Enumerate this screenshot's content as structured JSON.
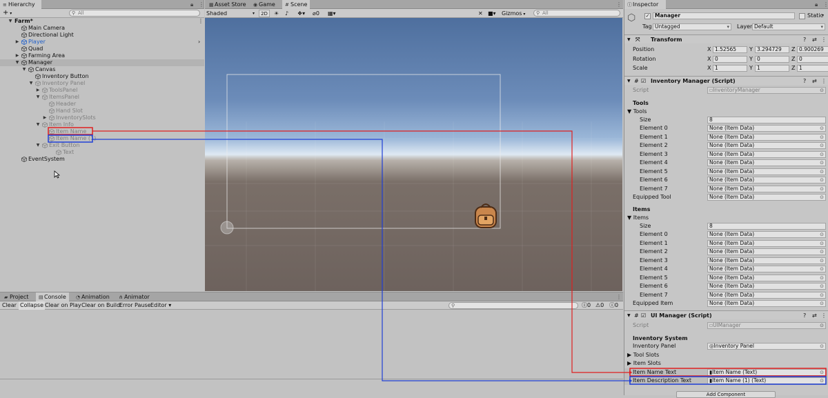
{
  "hierarchy": {
    "tab": "Hierarchy",
    "add": "+",
    "search_placeholder": "All",
    "rows": [
      {
        "label": "Farm*",
        "style": "bold"
      },
      {
        "label": "Main Camera"
      },
      {
        "label": "Directional Light"
      },
      {
        "label": "Player",
        "style": "blue"
      },
      {
        "label": "Quad"
      },
      {
        "label": "Farming Area"
      },
      {
        "label": "Manager",
        "style": "selected"
      },
      {
        "label": "Canvas"
      },
      {
        "label": "Inventory Button"
      },
      {
        "label": "Inventory Panel",
        "style": "dim"
      },
      {
        "label": "ToolsPanel",
        "style": "dim"
      },
      {
        "label": "ItemsPanel",
        "style": "dim"
      },
      {
        "label": "Header",
        "style": "dim"
      },
      {
        "label": "Hand Slot",
        "style": "dim"
      },
      {
        "label": "InventorySlots",
        "style": "dim"
      },
      {
        "label": "Item Info",
        "style": "dim"
      },
      {
        "label": "Item Name",
        "style": "dim"
      },
      {
        "label": "Item Name (1)",
        "style": "dim"
      },
      {
        "label": "Exit Button",
        "style": "dim"
      },
      {
        "label": "Text",
        "style": "dim"
      },
      {
        "label": "EventSystem"
      }
    ]
  },
  "scene_tabs": {
    "asset_store": "Asset Store",
    "game": "Game",
    "scene": "Scene"
  },
  "scene_toolbar": {
    "shading": "Shaded",
    "mode_2d": "2D",
    "gizmos": "Gizmos",
    "gizmo_count": "0",
    "search_placeholder": "All"
  },
  "bottom": {
    "tabs": {
      "project": "Project",
      "console": "Console",
      "animation": "Animation",
      "animator": "Animator"
    },
    "buttons": {
      "clear": "Clear",
      "collapse": "Collapse",
      "clear_on_play": "Clear on Play",
      "clear_on_build": "Clear on Build",
      "error_pause": "Error Pause",
      "editor": "Editor"
    },
    "counts": {
      "info": "0",
      "warn": "0",
      "error": "0"
    }
  },
  "inspector": {
    "tab": "Inspector",
    "object_name": "Manager",
    "static_label": "Static",
    "tag_label": "Tag",
    "tag_value": "Untagged",
    "layer_label": "Layer",
    "layer_value": "Default",
    "transform": {
      "title": "Transform",
      "position_label": "Position",
      "pos": {
        "x": "1.52565",
        "y": "3.294729",
        "z": "0.900269"
      },
      "rotation_label": "Rotation",
      "rot": {
        "x": "0",
        "y": "0",
        "z": "0"
      },
      "scale_label": "Scale",
      "scale": {
        "x": "1",
        "y": "1",
        "z": "1"
      }
    },
    "inventory_manager": {
      "title": "Inventory Manager (Script)",
      "script_label": "Script",
      "script_value": "InventoryManager",
      "tools_header": "Tools",
      "tools_foldout": "Tools",
      "size_label": "Size",
      "tools_size": "8",
      "tool_elements": [
        "Element 0",
        "Element 1",
        "Element 2",
        "Element 3",
        "Element 4",
        "Element 5",
        "Element 6",
        "Element 7"
      ],
      "none_value": "None (Item Data)",
      "equipped_tool_label": "Equipped Tool",
      "items_header": "Items",
      "items_foldout": "Items",
      "items_size": "8",
      "item_elements": [
        "Element 0",
        "Element 1",
        "Element 2",
        "Element 3",
        "Element 4",
        "Element 5",
        "Element 6",
        "Element 7"
      ],
      "equipped_item_label": "Equipped Item"
    },
    "ui_manager": {
      "title": "UI Manager (Script)",
      "script_label": "Script",
      "script_value": "UIManager",
      "inventory_system_header": "Inventory System",
      "inventory_panel_label": "Inventory Panel",
      "inventory_panel_value": "Inventory Panel",
      "tool_slots": "Tool Slots",
      "item_slots": "Item Slots",
      "item_name_text_label": "Item Name Text",
      "item_name_text_value": "Item Name (Text)",
      "item_desc_text_label": "Item Description Text",
      "item_desc_text_value": "Item Name (1) (Text)"
    },
    "add_component": "Add Component"
  },
  "colors": {
    "red_link": "#e02020",
    "blue_link": "#1f3fd6"
  }
}
